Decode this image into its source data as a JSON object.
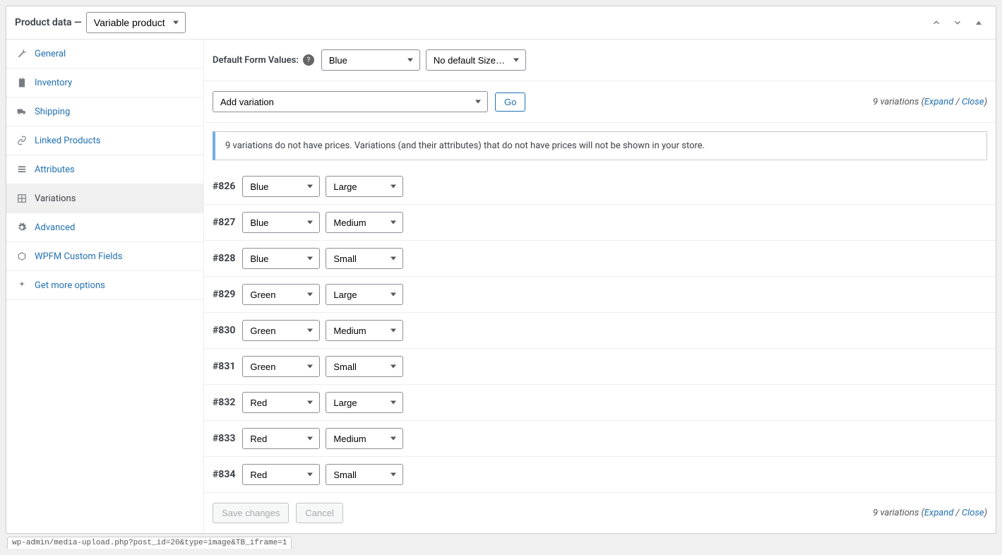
{
  "header": {
    "title_prefix": "Product data —",
    "product_type": "Variable product"
  },
  "tabs": [
    {
      "key": "general",
      "label": "General",
      "icon": "wrench"
    },
    {
      "key": "inventory",
      "label": "Inventory",
      "icon": "clipboard"
    },
    {
      "key": "shipping",
      "label": "Shipping",
      "icon": "truck"
    },
    {
      "key": "linked",
      "label": "Linked Products",
      "icon": "link"
    },
    {
      "key": "attributes",
      "label": "Attributes",
      "icon": "list"
    },
    {
      "key": "variations",
      "label": "Variations",
      "icon": "grid",
      "active": true
    },
    {
      "key": "advanced",
      "label": "Advanced",
      "icon": "gear"
    },
    {
      "key": "wpfm",
      "label": "WPFM Custom Fields",
      "icon": "box"
    },
    {
      "key": "getmore",
      "label": "Get more options",
      "icon": "sparkle"
    }
  ],
  "default_form": {
    "label": "Default Form Values:",
    "color_value": "Blue",
    "size_value": "No default Size…"
  },
  "add_action": {
    "value": "Add variation",
    "go_label": "Go"
  },
  "variation_meta": {
    "prefix": "9 variations (",
    "expand": "Expand",
    "sep": " / ",
    "close": "Close",
    "suffix": ")"
  },
  "notice": "9 variations do not have prices. Variations (and their attributes) that do not have prices will not be shown in your store.",
  "variations": [
    {
      "id": "#826",
      "color": "Blue",
      "size": "Large"
    },
    {
      "id": "#827",
      "color": "Blue",
      "size": "Medium"
    },
    {
      "id": "#828",
      "color": "Blue",
      "size": "Small"
    },
    {
      "id": "#829",
      "color": "Green",
      "size": "Large"
    },
    {
      "id": "#830",
      "color": "Green",
      "size": "Medium"
    },
    {
      "id": "#831",
      "color": "Green",
      "size": "Small"
    },
    {
      "id": "#832",
      "color": "Red",
      "size": "Large"
    },
    {
      "id": "#833",
      "color": "Red",
      "size": "Medium"
    },
    {
      "id": "#834",
      "color": "Red",
      "size": "Small"
    }
  ],
  "footer": {
    "save_label": "Save changes",
    "cancel_label": "Cancel"
  },
  "status_bar": "wp-admin/media-upload.php?post_id=20&type=image&TB_iframe=1"
}
